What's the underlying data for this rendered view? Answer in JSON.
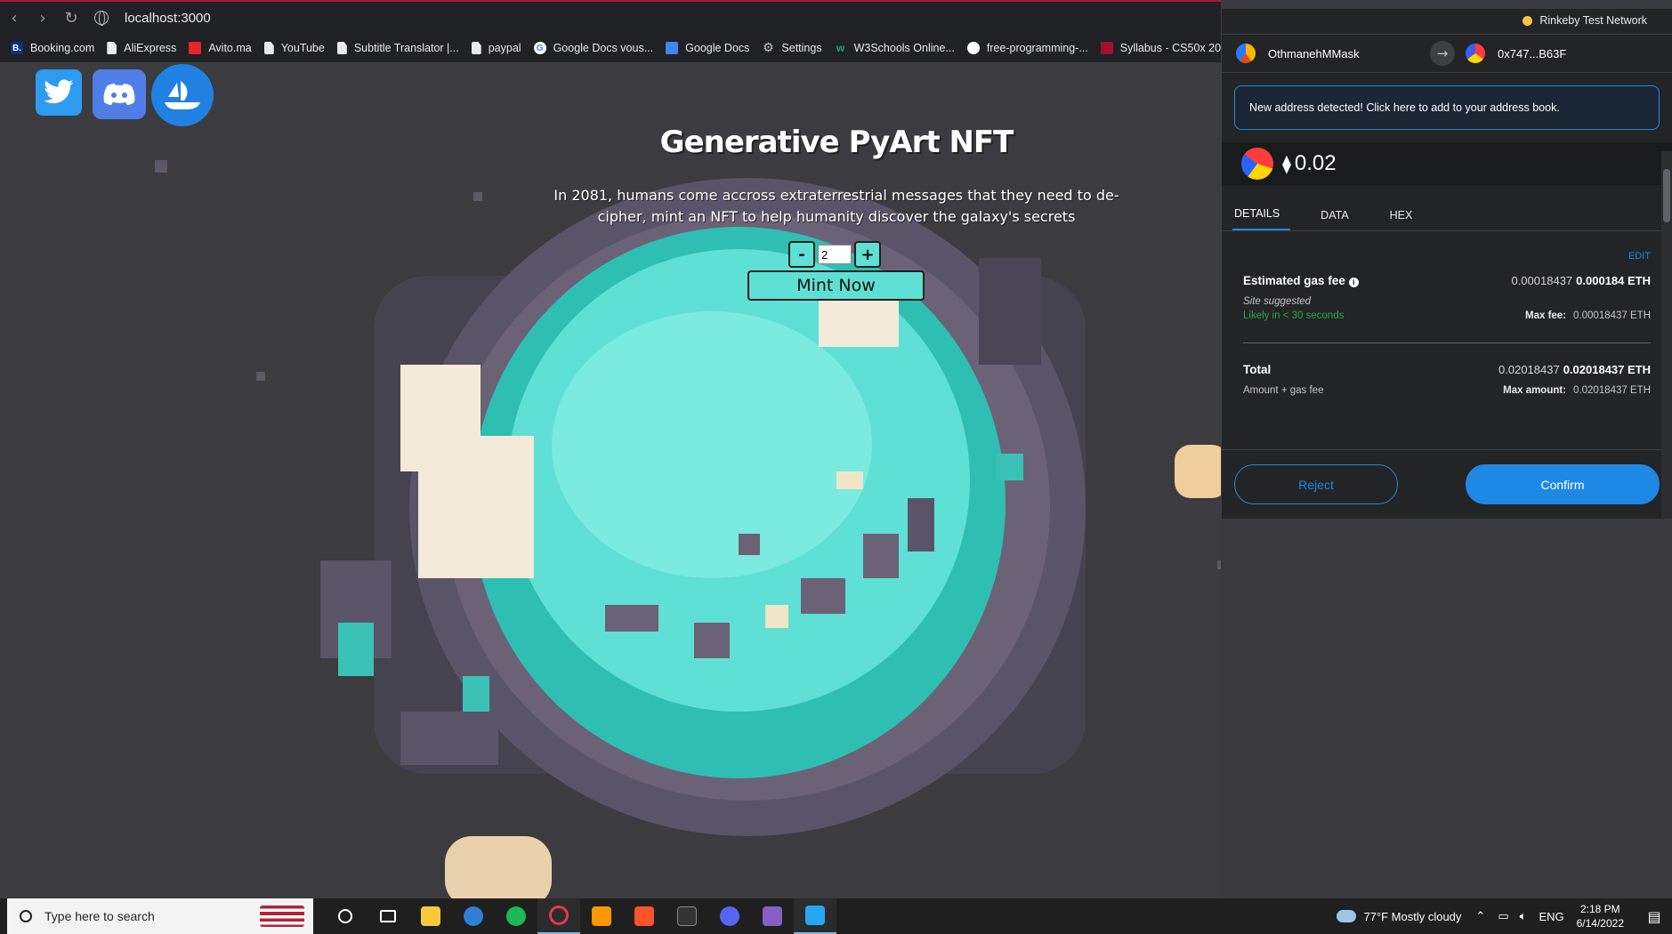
{
  "browser": {
    "url": "localhost:3000",
    "bookmarks": [
      {
        "label": "Booking.com",
        "icon": "booking-icon",
        "color": "#003580"
      },
      {
        "label": "AliExpress",
        "icon": "page-icon",
        "color": "#e8eaed"
      },
      {
        "label": "Avito.ma",
        "icon": "avito-icon",
        "color": "#e4272b"
      },
      {
        "label": "YouTube",
        "icon": "page-icon",
        "color": "#e8eaed"
      },
      {
        "label": "Subtitle Translator |...",
        "icon": "page-icon",
        "color": "#e8eaed"
      },
      {
        "label": "paypal",
        "icon": "page-icon",
        "color": "#e8eaed"
      },
      {
        "label": "Google Docs vous...",
        "icon": "google-icon",
        "color": "#ffffff"
      },
      {
        "label": "Google Docs",
        "icon": "docs-icon",
        "color": "#4285f4"
      },
      {
        "label": "Settings",
        "icon": "gear-icon",
        "color": "#bdc1c6"
      },
      {
        "label": "W3Schools Online...",
        "icon": "w3schools-icon",
        "color": "#04aa6d"
      },
      {
        "label": "free-programming-...",
        "icon": "github-icon",
        "color": "#ffffff"
      },
      {
        "label": "Syllabus - CS50x 20...",
        "icon": "harvard-icon",
        "color": "#a41034"
      }
    ]
  },
  "page": {
    "title": "Generative PyArt NFT",
    "subtitle": "In 2081, humans come accross extraterrestrial messages that they need to de-cipher, mint an NFT to help humanity discover the galaxy's secrets",
    "minus_label": "-",
    "plus_label": "+",
    "quantity": "2",
    "mint_label": "Mint Now",
    "social": [
      "twitter-icon",
      "discord-icon",
      "opensea-icon"
    ],
    "colors": {
      "teal": "#5fe0d4",
      "background": "#3b3b40"
    }
  },
  "metamask": {
    "network": "Rinkeby Test Network",
    "from_account": "OthmanehMMask",
    "to_account": "0x747...B63F",
    "notice": "New address detected! Click here to add to your address book.",
    "amount_value": "0.02",
    "tabs": [
      "DETAILS",
      "DATA",
      "HEX"
    ],
    "edit_label": "EDIT",
    "gas_label": "Estimated gas fee",
    "gas_value": "0.00018437",
    "gas_value_bold": "0.000184 ETH",
    "site_suggested": "Site suggested",
    "likely": "Likely in < 30 seconds",
    "max_fee_label": "Max fee:",
    "max_fee_value": "0.00018437 ETH",
    "total_label": "Total",
    "total_value": "0.02018437",
    "total_value_bold": "0.02018437 ETH",
    "amount_gas_label": "Amount + gas fee",
    "max_amount_label": "Max amount:",
    "max_amount_value": "0.02018437 ETH",
    "reject_label": "Reject",
    "confirm_label": "Confirm",
    "colors": {
      "accent": "#1e88e5",
      "success": "#28a745"
    }
  },
  "taskbar": {
    "search_placeholder": "Type here to search",
    "weather": "77°F  Mostly cloudy",
    "lang": "ENG",
    "time": "2:18 PM",
    "date": "6/14/2022"
  }
}
